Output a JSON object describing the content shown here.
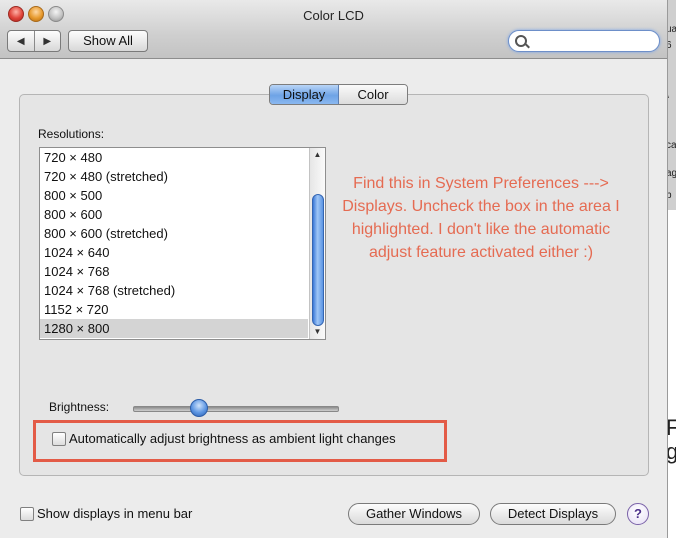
{
  "window": {
    "title": "Color LCD"
  },
  "toolbar": {
    "back_icon": "back-arrow-icon",
    "forward_icon": "forward-arrow-icon",
    "show_all_label": "Show All",
    "search_placeholder": ""
  },
  "tabs": [
    {
      "label": "Display",
      "active": true
    },
    {
      "label": "Color",
      "active": false
    }
  ],
  "resolutions": {
    "label": "Resolutions:",
    "items": [
      "720 × 480",
      "720 × 480 (stretched)",
      "800 × 500",
      "800 × 600",
      "800 × 600 (stretched)",
      "1024 × 640",
      "1024 × 768",
      "1024 × 768 (stretched)",
      "1152 × 720",
      "1280 × 800"
    ],
    "selected": "1280 × 800"
  },
  "annotation": {
    "text": "Find this in System Preferences ---> Displays.  Uncheck the box in the area I highlighted. I don't like the automatic adjust feature activated either :)",
    "color": "#e56b52"
  },
  "brightness": {
    "label": "Brightness:",
    "level": 0.33
  },
  "auto_brightness": {
    "label": "Automatically adjust brightness as ambient light changes",
    "checked": false
  },
  "show_displays": {
    "label": "Show displays in menu bar",
    "checked": false
  },
  "buttons": {
    "gather": "Gather Windows",
    "detect": "Detect Displays",
    "help": "?"
  },
  "background_window": {
    "fragments": [
      "ua",
      "6",
      "\\",
      "ca",
      "ag",
      "b"
    ],
    "big": [
      "F",
      "go"
    ]
  },
  "colors": {
    "highlight_border": "#e35b47",
    "accent": "#6ea3e6"
  }
}
